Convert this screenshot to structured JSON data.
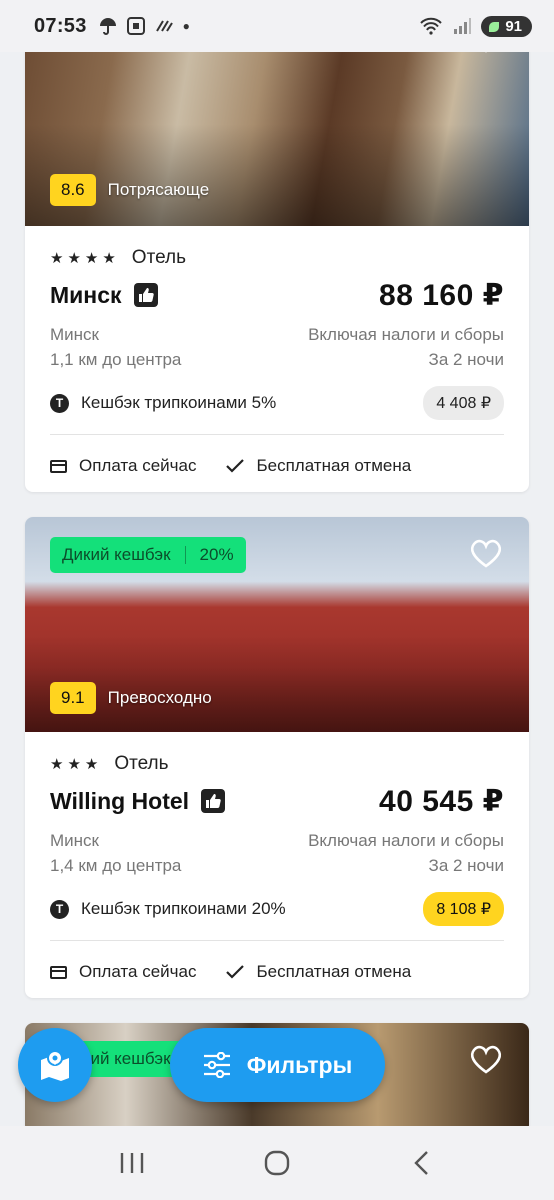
{
  "status_bar": {
    "time": "07:53",
    "battery": "91"
  },
  "hotels": [
    {
      "score": "8.6",
      "score_word": "Потрясающе",
      "stars_text": "★★★★",
      "type": "Отель",
      "name": "Минск",
      "price": "88 160 ₽",
      "city": "Минск",
      "distance": "1,1 км до центра",
      "tax_note": "Включая налоги и сборы",
      "nights": "За 2 ночи",
      "cashback_text": "Кешбэк трипкоинами 5%",
      "cashback_amount": "4 408 ₽",
      "payment": "Оплата сейчас",
      "cancel": "Бесплатная отмена"
    },
    {
      "promo_label": "Дикий кешбэк",
      "promo_percent": "20%",
      "score": "9.1",
      "score_word": "Превосходно",
      "stars_text": "★★★",
      "type": "Отель",
      "name": "Willing Hotel",
      "price": "40 545 ₽",
      "city": "Минск",
      "distance": "1,4 км до центра",
      "tax_note": "Включая налоги и сборы",
      "nights": "За 2 ночи",
      "cashback_text": "Кешбэк трипкоинами 20%",
      "cashback_amount": "8 108 ₽",
      "payment": "Оплата сейчас",
      "cancel": "Бесплатная отмена"
    },
    {
      "promo_label": "Дикий кешбэк"
    }
  ],
  "fab": {
    "filters_label": "Фильтры"
  },
  "colors": {
    "accent": "#1e9cf0",
    "rating": "#ffd41f",
    "promo": "#14e07a"
  }
}
